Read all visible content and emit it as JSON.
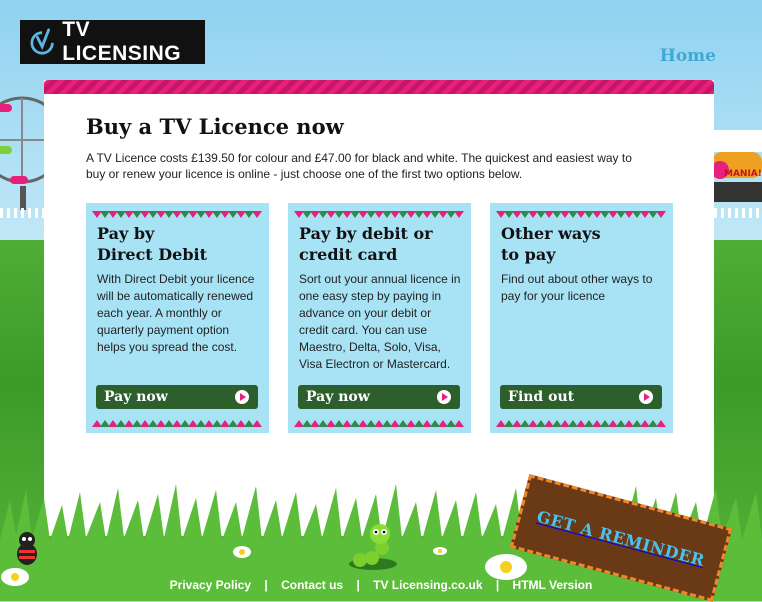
{
  "header": {
    "logo_text": "TV LICENSING",
    "home_link": "Home"
  },
  "main": {
    "title": "Buy a TV Licence now",
    "intro": "A TV Licence costs £139.50 for colour and £47.00 for black and white. The quickest and easiest way to buy or renew your licence is online - just choose one of the first two options below."
  },
  "cards": [
    {
      "title": "Pay by\nDirect Debit",
      "body": "With Direct Debit your licence will be automatically renewed each year. A monthly or quarterly payment option helps you spread the cost.",
      "button": "Pay now"
    },
    {
      "title": "Pay by debit or\ncredit card",
      "body": "Sort out your annual licence in one easy step by paying in advance on your debit or credit card. You can use Maestro, Delta, Solo, Visa, Visa Electron or Mastercard.",
      "button": "Pay now"
    },
    {
      "title": "Other ways\nto pay",
      "body": "Find out about other ways to pay for your licence",
      "button": "Find out"
    }
  ],
  "promo": {
    "reminder_label": "GET A REMINDER"
  },
  "footer": {
    "links": [
      "Privacy Policy",
      "Contact us",
      "TV Licensing.co.uk",
      "HTML Version"
    ],
    "separator": "|"
  },
  "colors": {
    "accent_pink": "#e8207c",
    "card_bg": "#a8e2f5",
    "button_green": "#2c5f2c",
    "link_blue": "#3fa9d4"
  },
  "icons": [
    "tv-licensing-logo-icon",
    "arrow-right-icon",
    "ferris-wheel-icon",
    "worm-icon",
    "ladybird-icon",
    "daisy-icon"
  ]
}
